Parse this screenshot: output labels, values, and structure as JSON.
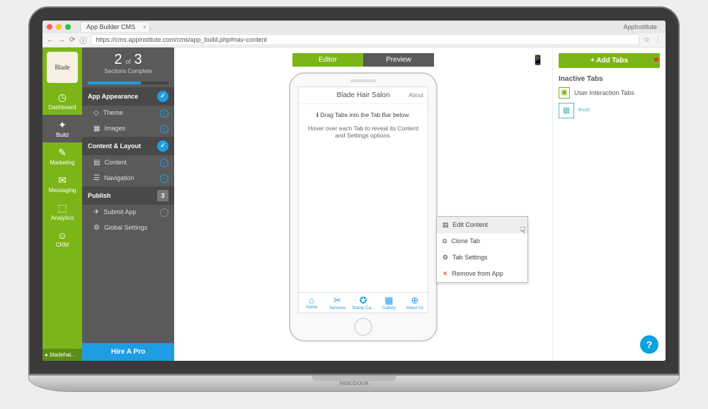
{
  "browser": {
    "tab_title": "App Builder CMS",
    "brand": "AppInstitute",
    "url": "https://cms.appinstitute.com/cms/app_build.php#nav-content"
  },
  "laptop_label": "MacBook",
  "rail": {
    "logo": "Blade",
    "items": [
      {
        "label": "Dashboard",
        "icon": "◷"
      },
      {
        "label": "Build",
        "icon": "✦"
      },
      {
        "label": "Marketing",
        "icon": "✎"
      },
      {
        "label": "Messaging",
        "icon": "✉"
      },
      {
        "label": "Analytics",
        "icon": "⬚"
      },
      {
        "label": "CRM",
        "icon": "☺"
      }
    ],
    "footer": "▸ bladehai..."
  },
  "panel": {
    "progress": {
      "current": "2",
      "of": "of",
      "total": "3",
      "label": "Sections Complete"
    },
    "sections": [
      {
        "title": "App Appearance",
        "status": "done",
        "items": [
          {
            "label": "Theme",
            "icon": "◇",
            "done": true
          },
          {
            "label": "Images",
            "icon": "▦",
            "done": true
          }
        ]
      },
      {
        "title": "Content & Layout",
        "status": "done",
        "items": [
          {
            "label": "Content",
            "icon": "▤",
            "done": true
          },
          {
            "label": "Navigation",
            "icon": "☰",
            "done": true
          }
        ]
      },
      {
        "title": "Publish",
        "status": "count",
        "count": "3",
        "items": [
          {
            "label": "Submit App",
            "icon": "✈",
            "done": false
          },
          {
            "label": "Global Settings",
            "icon": "⚙",
            "done": false
          }
        ]
      }
    ],
    "hire": "Hire A Pro"
  },
  "canvas": {
    "editor": "Editor",
    "preview": "Preview",
    "app_title": "Blade Hair Salon",
    "about": "About",
    "hint1": "Drag Tabs into the Tab Bar below.",
    "hint2": "Hover over each Tab to reveal its Content and Settings options.",
    "tabs": [
      {
        "label": "Home",
        "icon": "⌂"
      },
      {
        "label": "Services",
        "icon": "✂"
      },
      {
        "label": "Stamp Ca...",
        "icon": "✪"
      },
      {
        "label": "Gallery",
        "icon": "▦"
      },
      {
        "label": "About Us",
        "icon": "⊕"
      }
    ],
    "context": [
      {
        "label": "Edit Content",
        "icon": "▤"
      },
      {
        "label": "Clone Tab",
        "icon": "⧉"
      },
      {
        "label": "Tab Settings",
        "icon": "⚙"
      },
      {
        "label": "Remove from App",
        "icon": "✕",
        "remove": true
      }
    ]
  },
  "right": {
    "add": "+ Add Tabs",
    "inactive_hdr": "Inactive Tabs",
    "inactive": [
      {
        "label": "User Interaction Tabs",
        "icon": "▣"
      },
      {
        "label": "Book",
        "icon": "▦"
      }
    ]
  }
}
